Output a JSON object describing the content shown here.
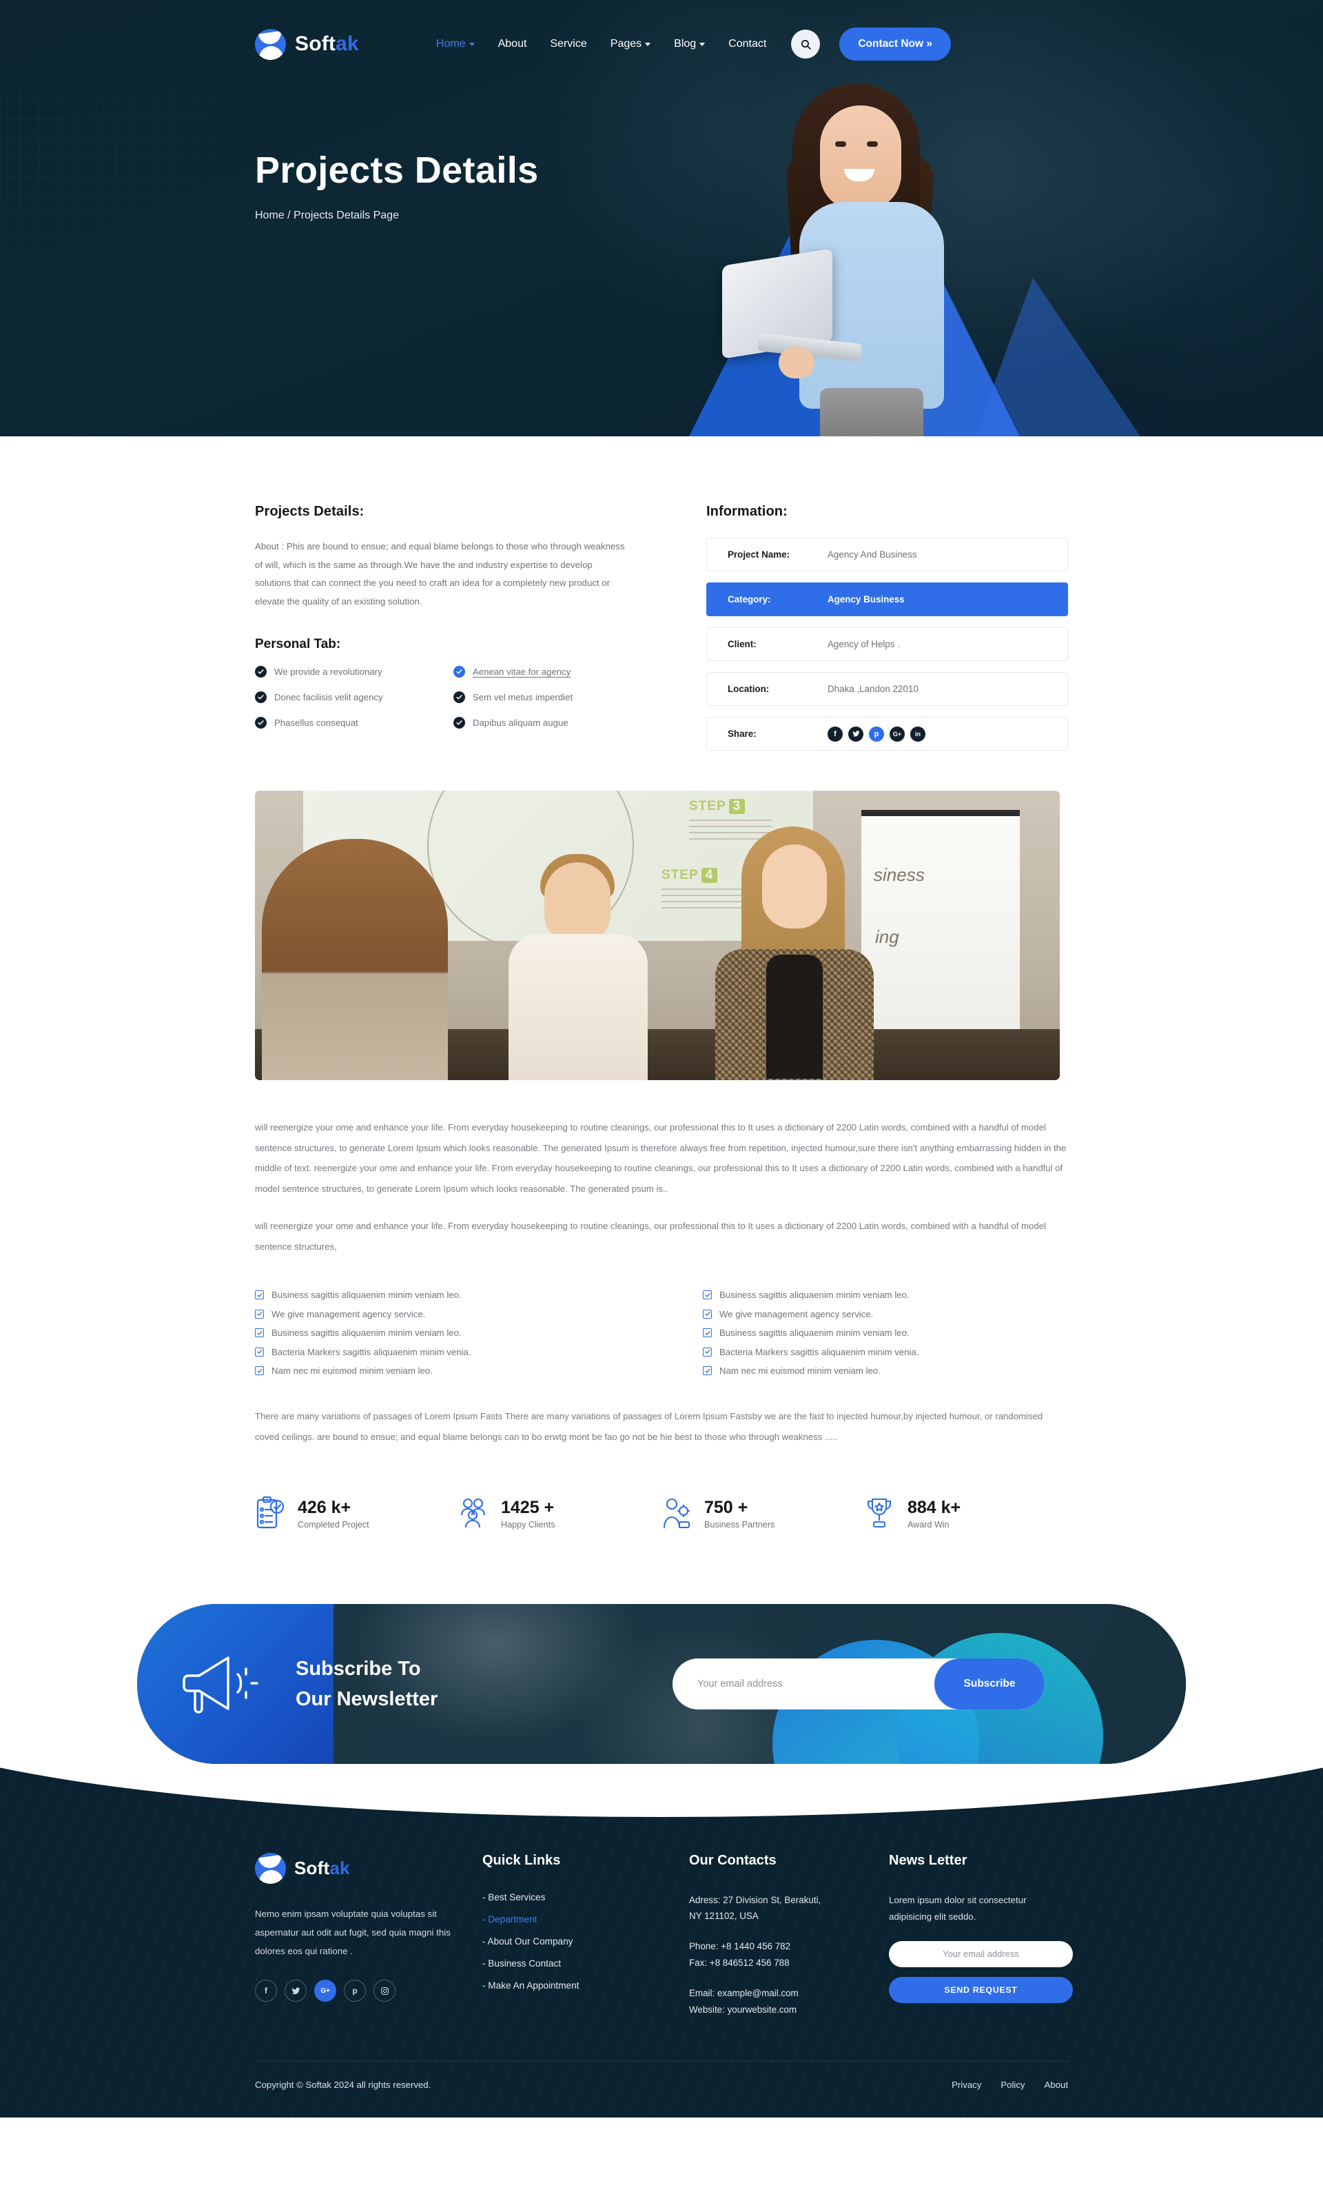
{
  "nav": {
    "brand_prefix": "Soft",
    "brand_accent": "ak",
    "links": [
      {
        "label": "Home",
        "has_caret": true,
        "active": true
      },
      {
        "label": "About",
        "has_caret": false,
        "active": false
      },
      {
        "label": "Service",
        "has_caret": false,
        "active": false
      },
      {
        "label": "Pages",
        "has_caret": true,
        "active": false
      },
      {
        "label": "Blog",
        "has_caret": true,
        "active": false
      },
      {
        "label": "Contact",
        "has_caret": false,
        "active": false
      }
    ],
    "search_icon": "search-icon",
    "cta_label": "Contact Now »"
  },
  "hero": {
    "title": "Projects Details",
    "breadcrumb": "Home / Projects Details Page"
  },
  "details": {
    "title": "Projects Details:",
    "paragraph": "About : Phis are bound to ensue; and equal blame belongs to those who through weakness of will, which is the same as through.We have the and industry expertise to develop solutions that can connect the you need to craft an idea for a completely new product or elevate the quality of an existing solution.",
    "personal_tab_title": "Personal Tab:",
    "personal_tab_left": [
      "We provide a revolutionary",
      "Donec facilisis velit agency",
      "Phasellus consequat"
    ],
    "personal_tab_right": [
      "Aenean vitae for agency ",
      "Sem vel metus imperdiet",
      "Dapibus aliquam augue"
    ]
  },
  "information": {
    "title": "Information:",
    "rows": [
      {
        "key": "Project Name:",
        "value": "Agency And Business",
        "highlight": false
      },
      {
        "key": "Category:",
        "value": "Agency Business",
        "highlight": true
      },
      {
        "key": "Client:",
        "value": "Agency of Helps .",
        "highlight": false
      },
      {
        "key": "Location:",
        "value": "Dhaka ,Landon 22010",
        "highlight": false
      }
    ],
    "share_label": "Share:",
    "share_icons": [
      {
        "name": "facebook-icon",
        "glyph": "f",
        "accent": false
      },
      {
        "name": "twitter-icon",
        "glyph": "✒",
        "accent": false
      },
      {
        "name": "pinterest-icon",
        "glyph": "р",
        "accent": true
      },
      {
        "name": "google-plus-icon",
        "glyph": "G+",
        "accent": false
      },
      {
        "name": "linkedin-icon",
        "glyph": "in",
        "accent": false
      }
    ]
  },
  "article": {
    "paragraph_1": "will reenergize your ome and enhance your life. From everyday housekeeping to routine cleanings, our professional this to It uses a dictionary of 2200 Latin words, combined with a handful of model sentence structures, to generate Lorem Ipsum which looks reasonable. The generated Ipsum is therefore always free from repetition, injected humour,sure there isn't anything embarrassing hidden in the middle of text. reenergize your ome and enhance your life. From everyday housekeeping to routine cleanings, our professional this to It uses a dictionary of 2200 Latin words, combined with a handful of model sentence structures, to generate Lorem Ipsum which looks reasonable. The generated psum is..",
    "paragraph_2": "will reenergize your ome and enhance your life. From everyday housekeeping to routine cleanings, our professional this to It uses a dictionary of 2200 Latin words, combined with a handful of model sentence structures,",
    "closing_paragraph": "There are many variations of passages of Lorem Ipsum Fasts There are many variations of passages of Lorem Ipsum Fastsby we are the fast to injected humour,by injected humour, or randomised coved ceilings. are bound to ensue; and equal blame belongs can to bo erwtg mont be fao go not be hie best to those who through weakness ....."
  },
  "feature_image": {
    "slide_step3": "STEP",
    "slide_step3_num": "3",
    "slide_step4": "STEP",
    "slide_step4_num": "4",
    "flipchart_line1": "siness",
    "flipchart_line2": "ing"
  },
  "checklist_left": [
    "Business sagittis aliquaenim minim veniam leo.",
    "We give management agency service.",
    "Business sagittis aliquaenim minim veniam leo.",
    "Bacteria Markers sagittis aliquaenim minim venia.",
    "Nam nec mi euismod minim veniam leo."
  ],
  "checklist_right": [
    "Business sagittis aliquaenim minim veniam leo.",
    "We give management agency service.",
    "Business sagittis aliquaenim minim veniam leo.",
    "Bacteria Markers sagittis aliquaenim minim venia.",
    "Nam nec mi euismod minim veniam leo."
  ],
  "counters": [
    {
      "icon": "clipboard-check-icon",
      "number": "426 k+",
      "label": "Completed Project"
    },
    {
      "icon": "people-group-icon",
      "number": "1425 +",
      "label": "Happy Clients"
    },
    {
      "icon": "business-person-icon",
      "number": "750 +",
      "label": "Business Partners"
    },
    {
      "icon": "trophy-icon",
      "number": "884 k+",
      "label": "Award Win"
    }
  ],
  "newsletter": {
    "icon": "megaphone-icon",
    "title_line1": "Subscribe To",
    "title_line2": "Our Newsletter",
    "input_placeholder": "Your email address",
    "input_value": "",
    "button_label": "Subscribe"
  },
  "footer": {
    "brand_prefix": "Soft",
    "brand_accent": "ak",
    "about": "Nemo enim ipsam voluptate quia voluptas sit aspernatur aut odit aut fugit, sed quia magni this dolores eos qui ratione .",
    "social": [
      {
        "name": "facebook-icon",
        "glyph": "f",
        "accent": false
      },
      {
        "name": "twitter-icon",
        "glyph": "✒",
        "accent": false
      },
      {
        "name": "google-plus-icon",
        "glyph": "G+",
        "accent": true
      },
      {
        "name": "pinterest-icon",
        "glyph": "р",
        "accent": false
      },
      {
        "name": "instagram-icon",
        "glyph": "▢",
        "accent": false
      }
    ],
    "quick_links_title": "Quick Links",
    "quick_links": [
      {
        "label": "- Best Services",
        "active": false
      },
      {
        "label": "- Department",
        "active": true
      },
      {
        "label": "- About Our Company",
        "active": false
      },
      {
        "label": "- Business Contact",
        "active": false
      },
      {
        "label": "- Make An Appointment",
        "active": false
      }
    ],
    "contacts_title": "Our Contacts",
    "address_line1": "Adress: 27 Division St, Berakuti,",
    "address_line2": "NY 121102, USA",
    "phone_line": "Phone: +8 1440 456 782",
    "fax_line": "Fax: +8 846512 456 788",
    "email_line": "Email: example@mail.com",
    "website_line": "Website: yourwebsite.com",
    "news_title": "News Letter",
    "news_copy": "Lorem ipsum dolor sit consectetur adipisicing elit seddo.",
    "news_placeholder": "Your email address",
    "news_value": "",
    "news_button": "SEND REQUEST",
    "copyright": "Copyright © Softak 2024 all rights reserved.",
    "bottom_links": [
      "Privacy",
      "Policy",
      "About"
    ]
  },
  "colors": {
    "accent": "#2f6ee8",
    "dark": "#0b2230",
    "hero_bg": "#0d2634"
  }
}
